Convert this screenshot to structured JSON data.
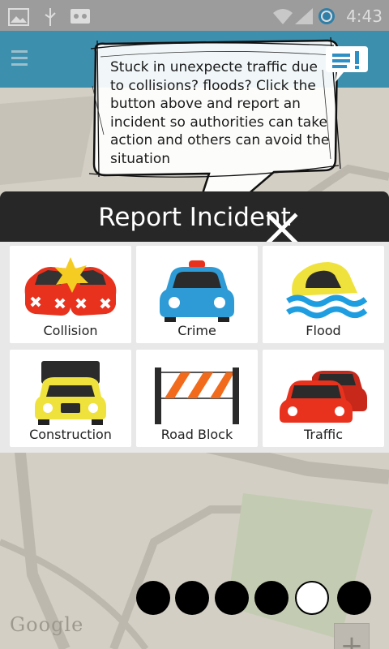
{
  "status_bar": {
    "time": "4:43",
    "icons": [
      "image-icon",
      "usb-icon",
      "voicemail-icon",
      "wifi-icon",
      "signal-icon",
      "alarm-icon"
    ]
  },
  "action_bar": {
    "menu_icon": "menu-icon",
    "report_icon": "chat-report-icon"
  },
  "tutorial": {
    "text": "Stuck in unexpecte traffic due to collisions? floods? Click the button above and report an incident so authorities can take action and others can avoid the situation"
  },
  "dialog": {
    "title": "Report Incident",
    "close_icon": "close-icon",
    "incidents": [
      {
        "label": "Collision",
        "icon": "collision-icon"
      },
      {
        "label": "Crime",
        "icon": "police-car-icon"
      },
      {
        "label": "Flood",
        "icon": "flood-icon"
      },
      {
        "label": "Construction",
        "icon": "construction-truck-icon"
      },
      {
        "label": "Road Block",
        "icon": "road-block-icon"
      },
      {
        "label": "Traffic",
        "icon": "traffic-icon"
      }
    ]
  },
  "map": {
    "attribution": "Google",
    "zoom_in": "+"
  },
  "pager": {
    "total": 6,
    "active_index": 4
  },
  "colors": {
    "action_bar": "#3d8fae",
    "dialog_header": "#272727",
    "car_red": "#e8321e",
    "car_blue": "#2e9bd6",
    "car_yellow": "#f0e23c",
    "water": "#1e9ee0"
  }
}
